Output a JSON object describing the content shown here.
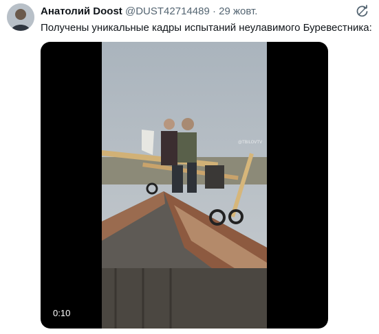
{
  "tweet": {
    "author_name": "Анатолий Doost",
    "handle": "@DUST42714489",
    "separator": "·",
    "date": "29 жовт.",
    "text": "Получены уникальные кадры испытаний неулавимого Буревестника:",
    "header_icon": "refresh-circle-icon"
  },
  "media": {
    "type": "video",
    "duration": "0:10",
    "watermark": "@TBILOVTV"
  },
  "colors": {
    "text_primary": "#0f1419",
    "text_secondary": "#536471",
    "media_background": "#000000"
  }
}
